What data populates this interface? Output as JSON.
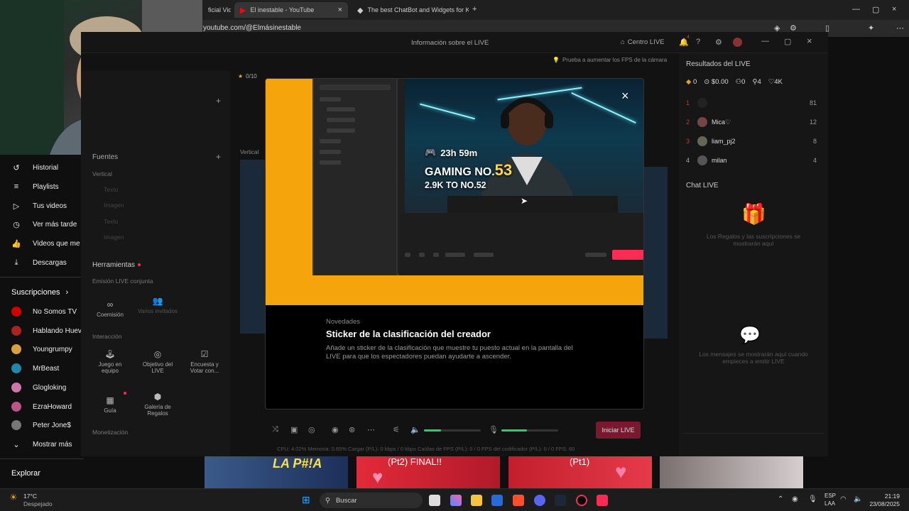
{
  "browser": {
    "tabs": [
      {
        "label": "ficial Vide"
      },
      {
        "label": "El inestable - YouTube"
      },
      {
        "label": "The best ChatBot and Widgets for Ki"
      }
    ],
    "url": "youtube.com/@Elmásinestable"
  },
  "yt_sidebar": {
    "items": [
      "Historial",
      "Playlists",
      "Tus videos",
      "Ver más tarde",
      "Videos que me g",
      "Descargas"
    ],
    "subs_header": "Suscripciones",
    "subs": [
      "No Somos TV",
      "Hablando Hueva",
      "Youngrumpy",
      "MrBeast",
      "Glogloking",
      "EzraHoward",
      "Peter Jone$"
    ],
    "show_more": "Mostrar más",
    "explore": "Explorar"
  },
  "studio": {
    "title": "Información sobre el LIVE",
    "centro": "Centro LIVE",
    "notif_count": "4",
    "fps_tip": "Prueba a aumentar los FPS de la cámara",
    "goal": "0/10",
    "left": {
      "fuentes": "Fuentes",
      "vertical": "Vertical",
      "sources": [
        "Texto",
        "Imagen",
        "Texto",
        "Imagen"
      ],
      "herramientas": "Herramientas",
      "emision": "Emisión LIVE conjunta",
      "coemision": "Coemisión",
      "varios": "Varios invitados",
      "interaccion": "Interacción",
      "tools": [
        "Juego en equipo",
        "Objetivo del LIVE",
        "Encuesta y Votar con..."
      ],
      "guia": "Guía",
      "galeria": "Galería de Regalos",
      "monetizacion": "Monetización"
    },
    "preview_label": "Vertical",
    "right": {
      "results_title": "Resultados del LIVE",
      "stats": [
        "0",
        "$0.00",
        "0",
        "4",
        "4K"
      ],
      "ranking": [
        {
          "pos": "1",
          "name": "",
          "score": "81"
        },
        {
          "pos": "2",
          "name": "Mica♡",
          "score": "12"
        },
        {
          "pos": "3",
          "name": "liam_pj2",
          "score": "8"
        },
        {
          "pos": "4",
          "name": "milan",
          "score": "4"
        }
      ],
      "chat_title": "Chat LIVE",
      "gifts_msg": "Los Regalos y las suscripciones se mostrarán aquí",
      "messages_msg": "Los mensajes se mostrarán aquí cuando empieces a emitir LIVE"
    },
    "start_btn": "Iniciar LIVE",
    "stats_bar": "CPU: 4.02%    Memoria: 0.65%    Cargar (P/L): 0 kbps / 0 kbps    Caídas de FPS (P/L): 0 / 0    FPS del codificador (P/L): 0 / 0    FPS: 60",
    "mic_level": 0.45,
    "volume_level": 0.3
  },
  "modal": {
    "game_timer": "23h 59m",
    "game_rank_prefix": "GAMING NO.",
    "game_rank": "53",
    "game_gap": "2.9K TO NO.52",
    "kicker": "Novedades",
    "title": "Sticker de la clasificación del creador",
    "description": "Añade un sticker de la clasificación que muestre tu puesto actual en la pantalla del LIVE para que los espectadores puedan ayudarte a ascender."
  },
  "thumbs": [
    "LA P#!A",
    "(Pt2) FINAL!!",
    "(Pt1)"
  ],
  "taskbar": {
    "weather_temp": "17°C",
    "weather_desc": "Despejado",
    "search": "Buscar",
    "lang1": "ESP",
    "lang2": "LAA",
    "time": "21:19",
    "date": "23/08/2025"
  },
  "colors": {
    "accent": "#fe2c55",
    "hero": "#f6a40c"
  }
}
